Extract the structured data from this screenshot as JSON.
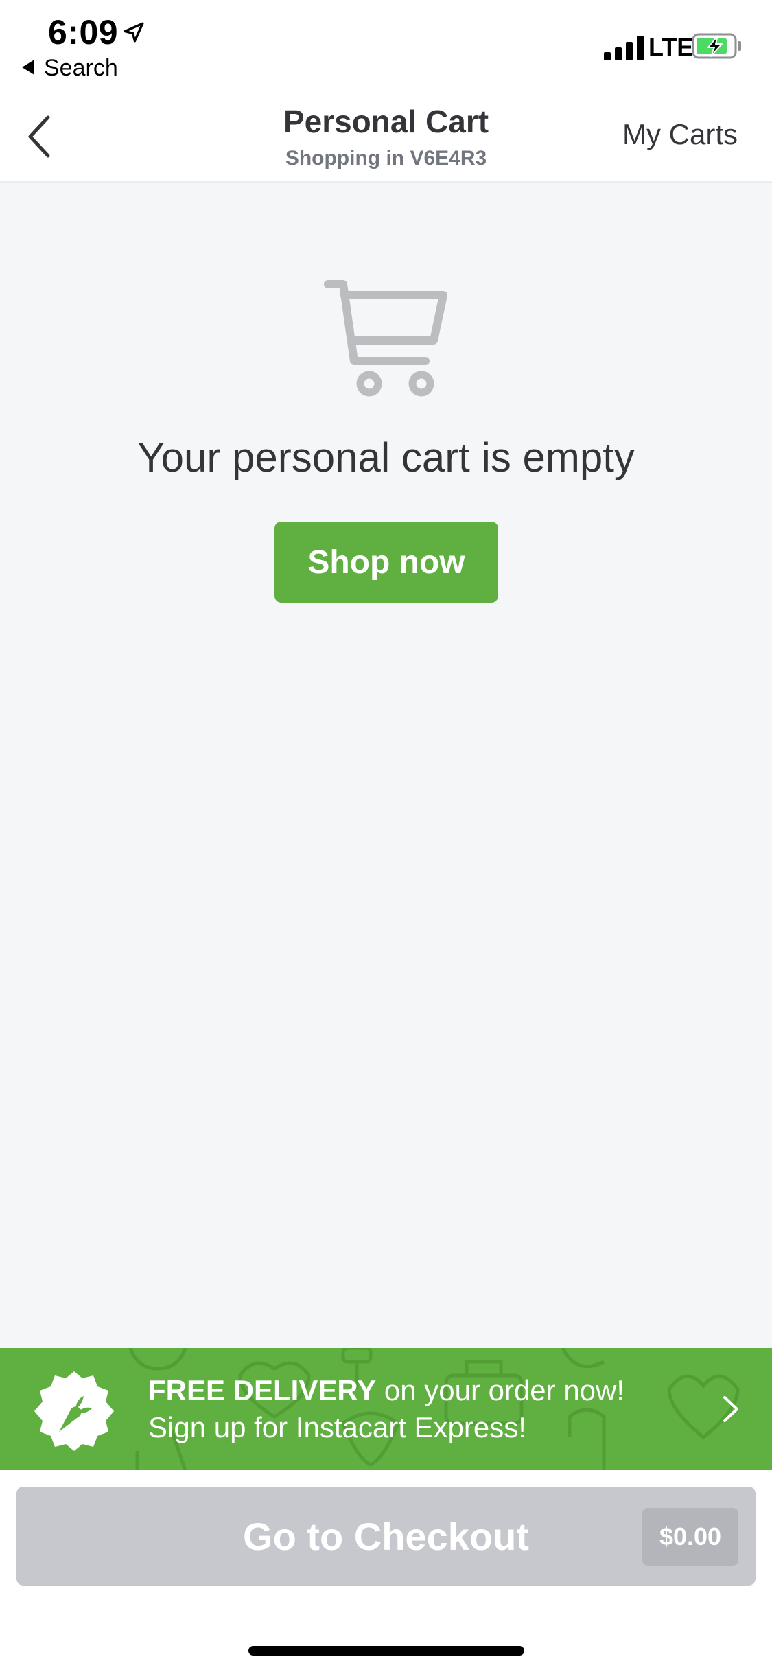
{
  "status_bar": {
    "time": "6:09",
    "back_app_label": "Search",
    "network": "LTE"
  },
  "nav": {
    "title": "Personal Cart",
    "subtitle": "Shopping in V6E4R3",
    "right_action": "My Carts"
  },
  "empty_state": {
    "icon": "cart-icon",
    "message": "Your personal cart is empty",
    "button_label": "Shop now"
  },
  "promo": {
    "highlight": "FREE DELIVERY",
    "line1_rest": " on your order now!",
    "line2": "Sign up for Instacart Express!"
  },
  "checkout": {
    "label": "Go to Checkout",
    "total": "$0.00"
  },
  "colors": {
    "brand_green": "#60af41",
    "disabled_gray": "#c7c8cd",
    "background": "#f5f6f8",
    "text_primary": "#343538"
  }
}
